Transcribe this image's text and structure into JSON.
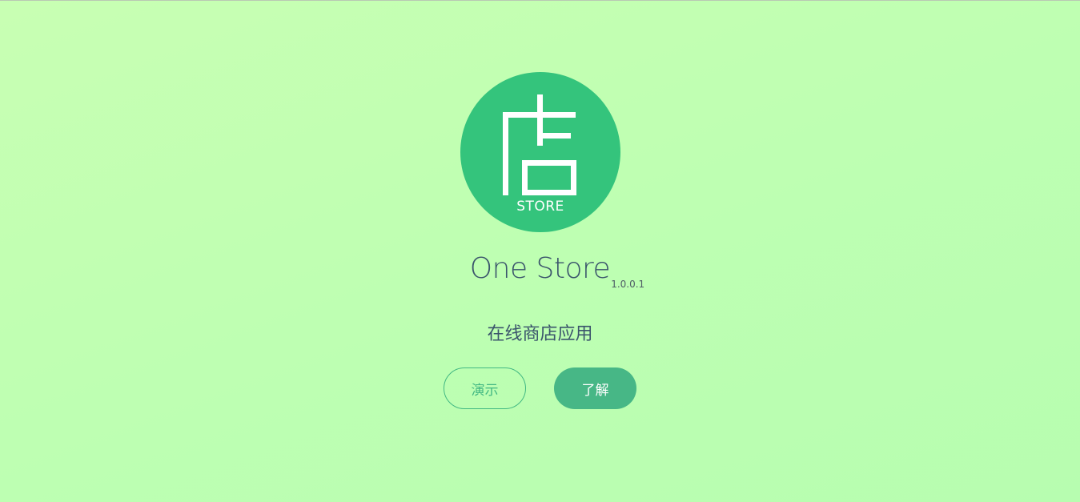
{
  "logo": {
    "glyph": "店",
    "label": "STORE",
    "background": "#34c47c"
  },
  "app": {
    "name": "One Store",
    "version": "1.0.0.1",
    "tagline": "在线商店应用"
  },
  "actions": {
    "demo_label": "演示",
    "learn_label": "了解"
  },
  "colors": {
    "accent": "#42b883",
    "text": "#3b556c",
    "background": "#c3ffb2"
  }
}
